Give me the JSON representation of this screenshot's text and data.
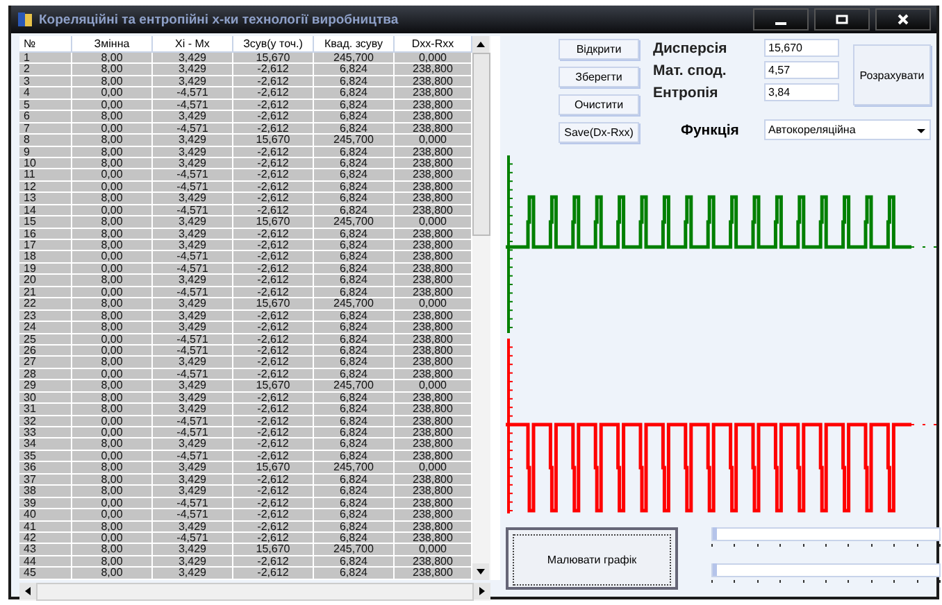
{
  "window": {
    "title": "Кореляційні та ентропійні х-ки технології виробництва"
  },
  "table": {
    "columns": [
      "№",
      "Змінна",
      "Xi - Mx",
      "Зсув(у точ.)",
      "Квад. зсуву",
      "Dxx-Rxx"
    ],
    "rows": [
      [
        "1",
        "8,00",
        "3,429",
        "15,670",
        "245,700",
        "0,000"
      ],
      [
        "2",
        "8,00",
        "3,429",
        "-2,612",
        "6,824",
        "238,800"
      ],
      [
        "3",
        "8,00",
        "3,429",
        "-2,612",
        "6,824",
        "238,800"
      ],
      [
        "4",
        "0,00",
        "-4,571",
        "-2,612",
        "6,824",
        "238,800"
      ],
      [
        "5",
        "0,00",
        "-4,571",
        "-2,612",
        "6,824",
        "238,800"
      ],
      [
        "6",
        "8,00",
        "3,429",
        "-2,612",
        "6,824",
        "238,800"
      ],
      [
        "7",
        "0,00",
        "-4,571",
        "-2,612",
        "6,824",
        "238,800"
      ],
      [
        "8",
        "8,00",
        "3,429",
        "15,670",
        "245,700",
        "0,000"
      ],
      [
        "9",
        "8,00",
        "3,429",
        "-2,612",
        "6,824",
        "238,800"
      ],
      [
        "10",
        "8,00",
        "3,429",
        "-2,612",
        "6,824",
        "238,800"
      ],
      [
        "11",
        "0,00",
        "-4,571",
        "-2,612",
        "6,824",
        "238,800"
      ],
      [
        "12",
        "0,00",
        "-4,571",
        "-2,612",
        "6,824",
        "238,800"
      ],
      [
        "13",
        "8,00",
        "3,429",
        "-2,612",
        "6,824",
        "238,800"
      ],
      [
        "14",
        "0,00",
        "-4,571",
        "-2,612",
        "6,824",
        "238,800"
      ],
      [
        "15",
        "8,00",
        "3,429",
        "15,670",
        "245,700",
        "0,000"
      ],
      [
        "16",
        "8,00",
        "3,429",
        "-2,612",
        "6,824",
        "238,800"
      ],
      [
        "17",
        "8,00",
        "3,429",
        "-2,612",
        "6,824",
        "238,800"
      ],
      [
        "18",
        "0,00",
        "-4,571",
        "-2,612",
        "6,824",
        "238,800"
      ],
      [
        "19",
        "0,00",
        "-4,571",
        "-2,612",
        "6,824",
        "238,800"
      ],
      [
        "20",
        "8,00",
        "3,429",
        "-2,612",
        "6,824",
        "238,800"
      ],
      [
        "21",
        "0,00",
        "-4,571",
        "-2,612",
        "6,824",
        "238,800"
      ],
      [
        "22",
        "8,00",
        "3,429",
        "15,670",
        "245,700",
        "0,000"
      ],
      [
        "23",
        "8,00",
        "3,429",
        "-2,612",
        "6,824",
        "238,800"
      ],
      [
        "24",
        "8,00",
        "3,429",
        "-2,612",
        "6,824",
        "238,800"
      ],
      [
        "25",
        "0,00",
        "-4,571",
        "-2,612",
        "6,824",
        "238,800"
      ],
      [
        "26",
        "0,00",
        "-4,571",
        "-2,612",
        "6,824",
        "238,800"
      ],
      [
        "27",
        "8,00",
        "3,429",
        "-2,612",
        "6,824",
        "238,800"
      ],
      [
        "28",
        "0,00",
        "-4,571",
        "-2,612",
        "6,824",
        "238,800"
      ],
      [
        "29",
        "8,00",
        "3,429",
        "15,670",
        "245,700",
        "0,000"
      ],
      [
        "30",
        "8,00",
        "3,429",
        "-2,612",
        "6,824",
        "238,800"
      ],
      [
        "31",
        "8,00",
        "3,429",
        "-2,612",
        "6,824",
        "238,800"
      ],
      [
        "32",
        "0,00",
        "-4,571",
        "-2,612",
        "6,824",
        "238,800"
      ],
      [
        "33",
        "0,00",
        "-4,571",
        "-2,612",
        "6,824",
        "238,800"
      ],
      [
        "34",
        "8,00",
        "3,429",
        "-2,612",
        "6,824",
        "238,800"
      ],
      [
        "35",
        "0,00",
        "-4,571",
        "-2,612",
        "6,824",
        "238,800"
      ],
      [
        "36",
        "8,00",
        "3,429",
        "15,670",
        "245,700",
        "0,000"
      ],
      [
        "37",
        "8,00",
        "3,429",
        "-2,612",
        "6,824",
        "238,800"
      ],
      [
        "38",
        "8,00",
        "3,429",
        "-2,612",
        "6,824",
        "238,800"
      ],
      [
        "39",
        "0,00",
        "-4,571",
        "-2,612",
        "6,824",
        "238,800"
      ],
      [
        "40",
        "0,00",
        "-4,571",
        "-2,612",
        "6,824",
        "238,800"
      ],
      [
        "41",
        "8,00",
        "3,429",
        "-2,612",
        "6,824",
        "238,800"
      ],
      [
        "42",
        "0,00",
        "-4,571",
        "-2,612",
        "6,824",
        "238,800"
      ],
      [
        "43",
        "8,00",
        "3,429",
        "15,670",
        "245,700",
        "0,000"
      ],
      [
        "44",
        "8,00",
        "3,429",
        "-2,612",
        "6,824",
        "238,800"
      ],
      [
        "45",
        "8,00",
        "3,429",
        "-2,612",
        "6,824",
        "238,800"
      ]
    ]
  },
  "file_buttons": [
    "Відкрити",
    "Зберегти",
    "Очистити",
    "Save(Dx-Rxx)"
  ],
  "stats": [
    {
      "label": "Дисперсія",
      "value": "15,670"
    },
    {
      "label": "Мат. спод.",
      "value": "4,57"
    },
    {
      "label": "Ентропія",
      "value": "3,84"
    }
  ],
  "calculate_button": "Розрахувати",
  "function": {
    "label": "Функція",
    "value": "Автокореляційна"
  },
  "draw_button": "Малювати графік",
  "sliders": [
    {
      "level": 0
    },
    {
      "level": 0
    }
  ]
}
